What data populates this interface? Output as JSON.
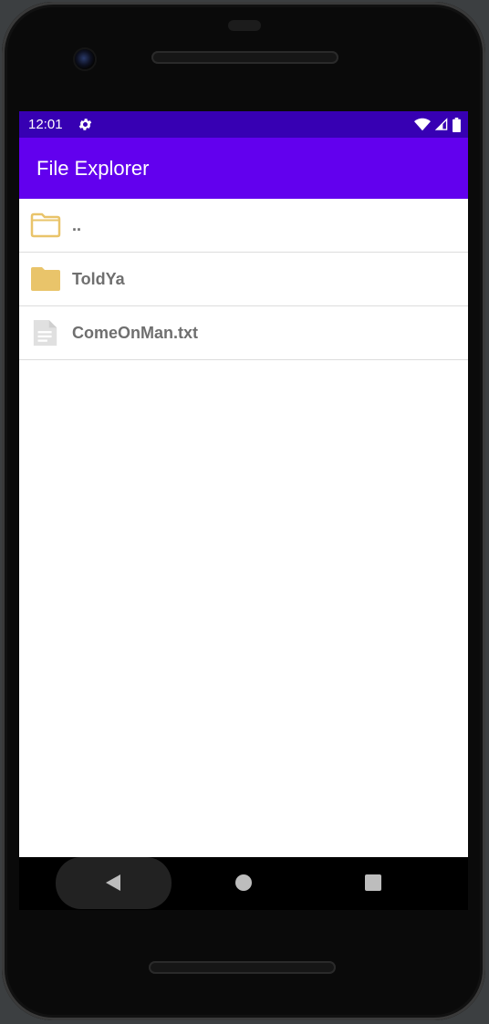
{
  "status_bar": {
    "time": "12:01",
    "settings_icon": "gear-icon",
    "wifi_icon": "wifi-icon",
    "signal_icon": "signal-icon",
    "battery_icon": "battery-icon"
  },
  "app_bar": {
    "title": "File Explorer"
  },
  "files": [
    {
      "label": "..",
      "icon": "folder-outline-icon"
    },
    {
      "label": "ToldYa",
      "icon": "folder-icon"
    },
    {
      "label": "ComeOnMan.txt",
      "icon": "document-icon"
    }
  ],
  "navigation": {
    "back_icon": "back-icon",
    "home_icon": "home-icon",
    "recents_icon": "recents-icon"
  },
  "colors": {
    "status_bar": "#3700b3",
    "app_bar": "#6200ee",
    "folder": "#e9c46a",
    "document": "#e0e0e0",
    "file_text": "#6f6f6f"
  }
}
